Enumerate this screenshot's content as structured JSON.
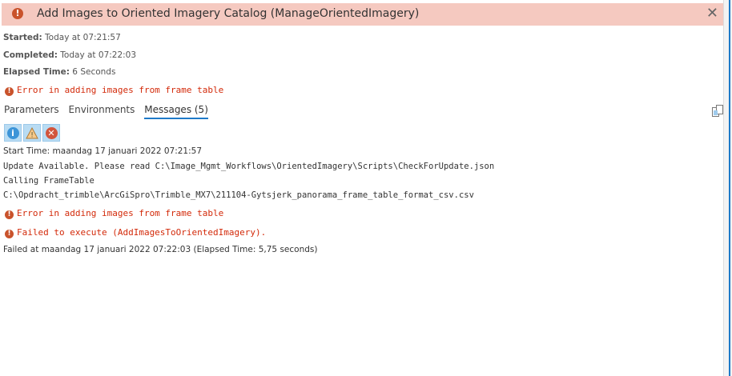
{
  "header": {
    "title": "Add Images to Oriented Imagery Catalog (ManageOrientedImagery)",
    "close": "✕"
  },
  "meta": {
    "started_label": "Started:",
    "started": "Today at 07:21:57",
    "completed_label": "Completed:",
    "completed": "Today at 07:22:03",
    "elapsed_label": "Elapsed Time:",
    "elapsed": "6 Seconds"
  },
  "summary_error": "Error in adding images from frame table",
  "tabs": [
    {
      "label": "Parameters"
    },
    {
      "label": "Environments"
    },
    {
      "label": "Messages (5)",
      "active": true
    }
  ],
  "messages": [
    "Start Time: maandag 17 januari 2022 07:21:57",
    "Update Available. Please read C:\\Image_Mgmt_Workflows\\OrientedImagery\\Scripts\\CheckForUpdate.json",
    "Calling FrameTable",
    "C:\\Opdracht_trimble\\ArcGiSpro\\Trimble_MX7\\211104-Gytsjerk_panorama_frame_table_format_csv.csv",
    "Error in adding images from frame table",
    "Failed to execute (AddImagesToOrientedImagery).",
    "Failed at maandag 17 januari 2022 07:22:03 (Elapsed Time: 5,75 seconds)"
  ]
}
